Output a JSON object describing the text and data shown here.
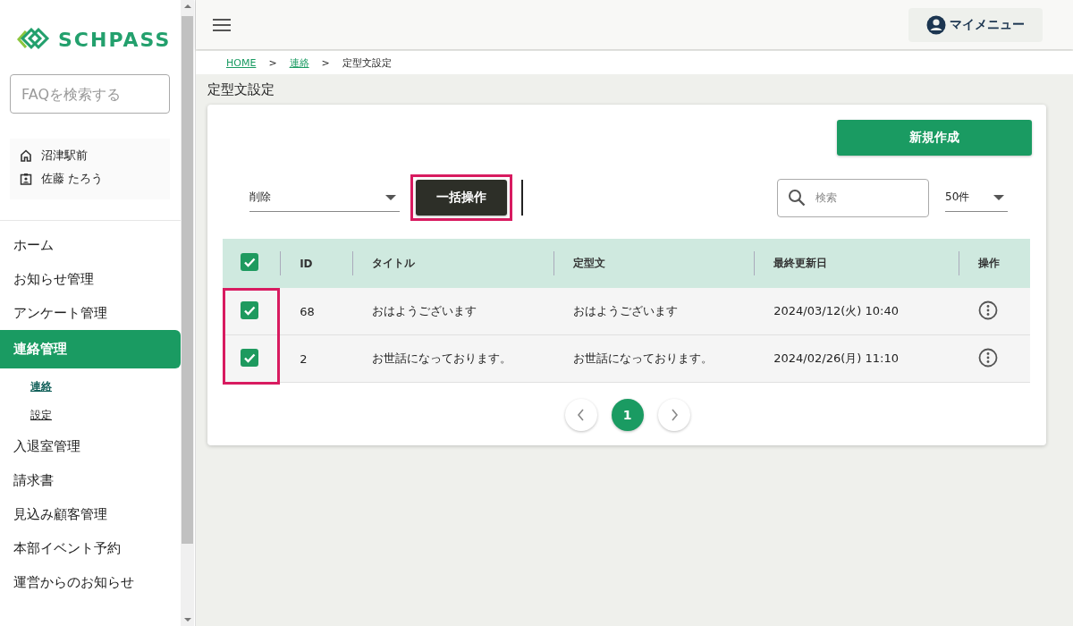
{
  "sidebar": {
    "logo": "SCHPASS",
    "faq_search": {
      "placeholder": "FAQを検索する"
    },
    "school": "沼津駅前",
    "user": "佐藤 たろう",
    "items": [
      {
        "label": "ホーム",
        "selected": false
      },
      {
        "label": "お知らせ管理",
        "selected": false
      },
      {
        "label": "アンケート管理",
        "selected": false
      },
      {
        "label": "連絡管理",
        "selected": true,
        "children": [
          {
            "label": "連絡",
            "selected": true
          },
          {
            "label": "設定",
            "selected": false
          }
        ]
      },
      {
        "label": "入退室管理",
        "selected": false
      },
      {
        "label": "請求書",
        "selected": false
      },
      {
        "label": "見込み顧客管理",
        "selected": false
      },
      {
        "label": "本部イベント予約",
        "selected": false
      },
      {
        "label": "運営からのお知らせ",
        "selected": false
      }
    ]
  },
  "header": {
    "my_menu": "マイメニュー"
  },
  "breadcrumb": [
    {
      "label": "HOME",
      "link": true
    },
    {
      "label": "連絡",
      "link": true
    },
    {
      "label": "定型文設定",
      "link": false
    }
  ],
  "breadcrumb_separator": ">",
  "page_title": "定型文設定",
  "new_button": "新規作成",
  "bulk_action": {
    "value": "削除",
    "button": "一括操作",
    "highlighted": true
  },
  "search": {
    "placeholder": "検索"
  },
  "per_page": "50件",
  "table": {
    "all_checked": true,
    "checkbox_column_highlighted": true,
    "columns": [
      "ID",
      "タイトル",
      "定型文",
      "最終更新日",
      "操作"
    ],
    "rows": [
      {
        "checked": true,
        "id": "68",
        "title": "おはようございます",
        "text": "おはようございます",
        "updated": "2024/03/12(火) 10:40"
      },
      {
        "checked": true,
        "id": "2",
        "title": "お世話になっております。",
        "text": "お世話になっております。",
        "updated": "2024/02/26(月) 11:10"
      }
    ]
  },
  "pagination": {
    "pages": [
      {
        "label": "1",
        "selected": true
      }
    ]
  }
}
